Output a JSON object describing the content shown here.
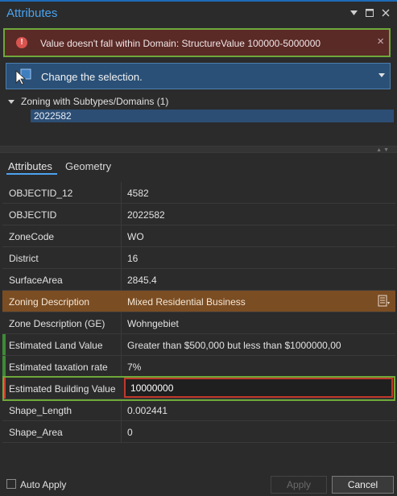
{
  "window": {
    "title": "Attributes",
    "controls": [
      "dropdown-icon",
      "restore-icon",
      "close-icon"
    ]
  },
  "error": {
    "message": "Value doesn't fall within Domain: StructureValue 100000-5000000",
    "icon": "error-icon",
    "close": "×"
  },
  "selection": {
    "label": "Change the selection."
  },
  "tree": {
    "layer": "Zoning with Subtypes/Domains (1)",
    "feature": "2022582"
  },
  "tabs": {
    "attributes": "Attributes",
    "geometry": "Geometry"
  },
  "attributes": [
    {
      "field": "OBJECTID_12",
      "value": "4582"
    },
    {
      "field": "OBJECTID",
      "value": "2022582"
    },
    {
      "field": "ZoneCode",
      "value": "WO"
    },
    {
      "field": "District",
      "value": "16"
    },
    {
      "field": "SurfaceArea",
      "value": "2845.4"
    },
    {
      "field": "Zoning Description",
      "value": "Mixed Residential Business"
    },
    {
      "field": "Zone Description (GE)",
      "value": "Wohngebiet"
    },
    {
      "field": "Estimated Land Value",
      "value": "Greater than $500,000 but less than $1000000,00"
    },
    {
      "field": "Estimated taxation rate",
      "value": "7%"
    },
    {
      "field": "Estimated Building Value",
      "value": "10000000"
    },
    {
      "field": "Shape_Length",
      "value": "0.002441"
    },
    {
      "field": "Shape_Area",
      "value": "0"
    }
  ],
  "footer": {
    "auto_apply": "Auto Apply",
    "apply": "Apply",
    "cancel": "Cancel"
  },
  "colors": {
    "accent": "#4aa3f0",
    "error_bg": "#5a2a27",
    "highlight_outline": "#6ea83a",
    "subtype_row": "#7b4d23",
    "invalid": "#d23b2c"
  }
}
